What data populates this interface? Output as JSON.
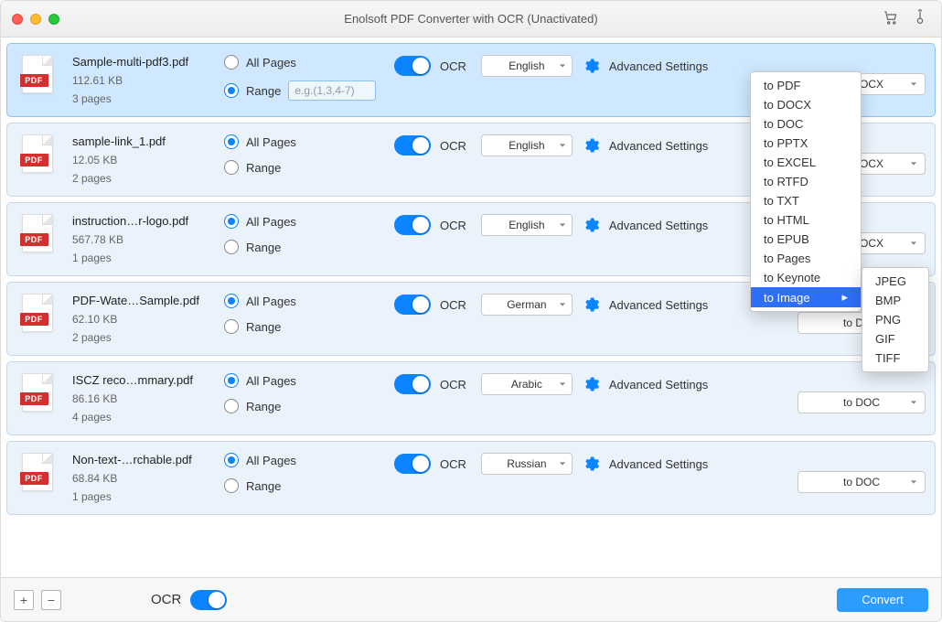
{
  "window": {
    "title": "Enolsoft PDF Converter with OCR (Unactivated)"
  },
  "toolbar_icons": {
    "cart": "cart-icon",
    "thermometer": "thermometer-icon"
  },
  "labels": {
    "all_pages": "All Pages",
    "range": "Range",
    "ocr": "OCR",
    "advanced": "Advanced Settings",
    "range_placeholder": "e.g.(1,3,4-7)"
  },
  "pdf_band": "PDF",
  "rows": [
    {
      "name": "Sample-multi-pdf3.pdf",
      "size": "112.61 KB",
      "pages": "3 pages",
      "range_selected": true,
      "lang": "English",
      "fmt": "to DOCX",
      "selected": true
    },
    {
      "name": "sample-link_1.pdf",
      "size": "12.05 KB",
      "pages": "2 pages",
      "range_selected": false,
      "lang": "English",
      "fmt": "to DOCX"
    },
    {
      "name": "instruction…r-logo.pdf",
      "size": "567.78 KB",
      "pages": "1 pages",
      "range_selected": false,
      "lang": "English",
      "fmt": "to DOCX"
    },
    {
      "name": "PDF-Wate…Sample.pdf",
      "size": "62.10 KB",
      "pages": "2 pages",
      "range_selected": false,
      "lang": "German",
      "fmt": "to DOC"
    },
    {
      "name": "ISCZ reco…mmary.pdf",
      "size": "86.16 KB",
      "pages": "4 pages",
      "range_selected": false,
      "lang": "Arabic",
      "fmt": "to DOC"
    },
    {
      "name": "Non-text-…rchable.pdf",
      "size": "68.84 KB",
      "pages": "1 pages",
      "range_selected": false,
      "lang": "Russian",
      "fmt": "to DOC"
    }
  ],
  "format_menu": [
    "to PDF",
    "to DOCX",
    "to DOC",
    "to PPTX",
    "to EXCEL",
    "to RTFD",
    "to TXT",
    "to HTML",
    "to EPUB",
    "to Pages",
    "to Keynote",
    "to Image"
  ],
  "format_menu_highlight": "to Image",
  "image_submenu": [
    "JPEG",
    "BMP",
    "PNG",
    "GIF",
    "TIFF"
  ],
  "bottom": {
    "ocr_label": "OCR",
    "convert": "Convert",
    "plus": "+",
    "minus": "−"
  }
}
